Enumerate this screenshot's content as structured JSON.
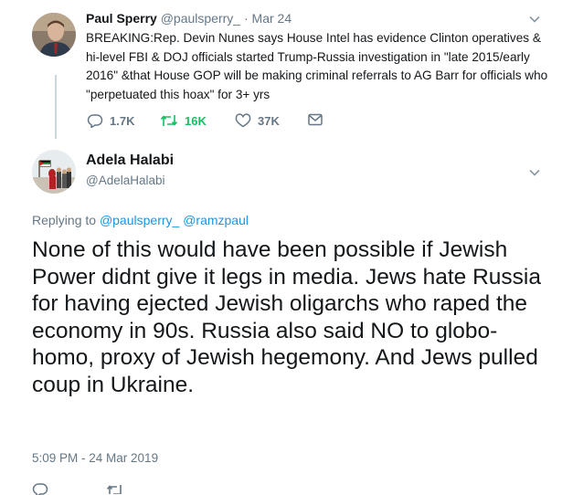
{
  "parent_tweet": {
    "author_name": "Paul Sperry",
    "handle": "@paulsperry_",
    "separator": "·",
    "date": "Mar 24",
    "text": "BREAKING:Rep. Devin Nunes says House Intel has evidence Clinton operatives & hi-level FBI & DOJ officials started Trump-Russia investigation in \"late 2015/early 2016\" &that House GOP will be making criminal referrals to AG Barr for officials who \"perpetuated this hoax\" for 3+ yrs",
    "replies": "1.7K",
    "retweets": "16K",
    "likes": "37K",
    "retweet_color": "#17bf63"
  },
  "main_tweet": {
    "author_name": "Adela Halabi",
    "handle": "@AdelaHalabi",
    "replying_prefix": "Replying to",
    "replying_to_1": "@paulsperry_",
    "replying_to_2": "@ramzpaul",
    "text": "None of this would have been possible if Jewish Power didnt give it legs in media. Jews hate Russia for having ejected Jewish oligarchs who raped the economy in 90s. Russia also said NO to globo-homo, proxy of Jewish hegemony. And Jews pulled coup in Ukraine.",
    "timestamp": "5:09 PM - 24 Mar 2019"
  },
  "colors": {
    "link": "#1b95e0",
    "muted": "#657786",
    "text": "#14171a"
  }
}
